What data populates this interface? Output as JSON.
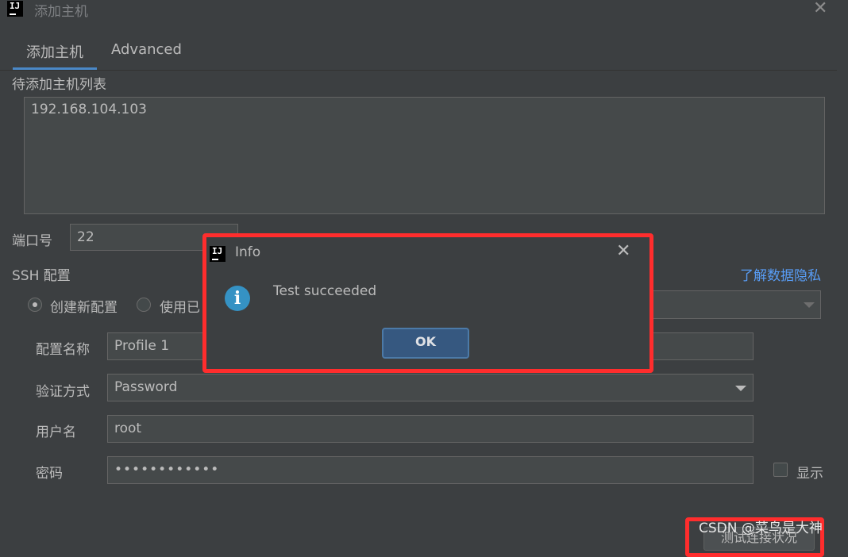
{
  "window": {
    "title": "添加主机",
    "close_icon": "close-icon"
  },
  "tabs": [
    {
      "label": "添加主机",
      "selected": true
    },
    {
      "label": "Advanced",
      "selected": false
    }
  ],
  "hosts": {
    "label": "待添加主机列表",
    "value": "192.168.104.103"
  },
  "port": {
    "label": "端口号",
    "value": "22"
  },
  "ssh": {
    "label": "SSH 配置",
    "privacy_link": "了解数据隐私",
    "radio_new": "创建新配置",
    "radio_existing": "使用已",
    "profile_label": "配置名称",
    "profile_value": "Profile 1",
    "auth_label": "验证方式",
    "auth_value": "Password",
    "user_label": "用户名",
    "user_value": "root",
    "password_label": "密码",
    "password_value": "••••••••••••",
    "show_label": "显示"
  },
  "bottom": {
    "test_button": "测试连接状况",
    "watermark": "CSDN @菜鸟是大神"
  },
  "dialog": {
    "title": "Info",
    "message": "Test succeeded",
    "ok_label": "OK"
  },
  "colors": {
    "accent": "#4a88c7",
    "highlight": "#ff2d2d",
    "background": "#3c3f41"
  }
}
